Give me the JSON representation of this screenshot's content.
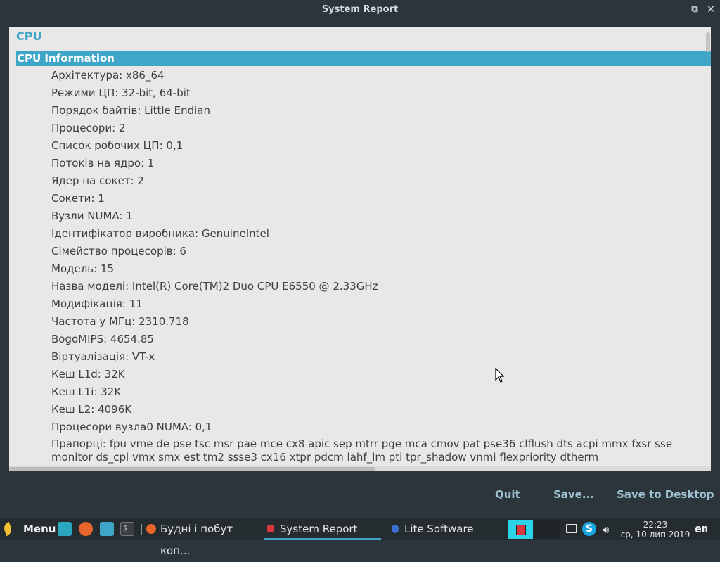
{
  "window": {
    "title": "System Report"
  },
  "report": {
    "category_title": "CPU",
    "section_header": "CPU Information",
    "rows": [
      "Архітектура: x86_64",
      "Режими ЦП: 32-bit, 64-bit",
      "Порядок байтів: Little Endian",
      "Процесори: 2",
      "Список робочих ЦП: 0,1",
      "Потоків на ядро: 1",
      "Ядер на сокет: 2",
      "Сокети: 1",
      "Вузли NUMA: 1",
      "Ідентифікатор виробника: GenuineIntel",
      "Сімейство процесорів: 6",
      "Модель: 15",
      "Назва моделі: Intel(R) Core(TM)2 Duo CPU E6550 @ 2.33GHz",
      "Модифікація: 11",
      "Частота у МГц: 2310.718",
      "BogoMIPS: 4654.85",
      "Віртуалізація: VT-x",
      "Кеш L1d: 32K",
      "Кеш L1i: 32K",
      "Кеш L2: 4096K",
      "Процесори вузла0 NUMA: 0,1"
    ],
    "flags_line1": "Прапорці: fpu vme de pse tsc msr pae mce cx8 apic sep mtrr pge mca cmov pat pse36 clflush dts acpi mmx fxsr sse",
    "flags_line2": "monitor ds_cpl vmx smx est tm2 ssse3 cx16 xtpr pdcm lahf_lm pti tpr_shadow vnmi flexpriority dtherm"
  },
  "actions": {
    "quit": "Quit",
    "save": "Save...",
    "save_desktop": "Save to Desktop"
  },
  "taskbar": {
    "menu_label": "Menu",
    "tasks": [
      {
        "label": "Будні і побут коп...",
        "icon": "firefox-icon"
      },
      {
        "label": "System Report",
        "icon": "system-report-icon"
      },
      {
        "label": "Lite Software",
        "icon": "lite-software-icon"
      }
    ],
    "clock_time": "22:23",
    "clock_date": "ср, 10 лип 2019",
    "language": "en"
  },
  "colors": {
    "accent": "#3fa6c8",
    "background": "#2b353b",
    "panel": "#e8e8e8"
  }
}
